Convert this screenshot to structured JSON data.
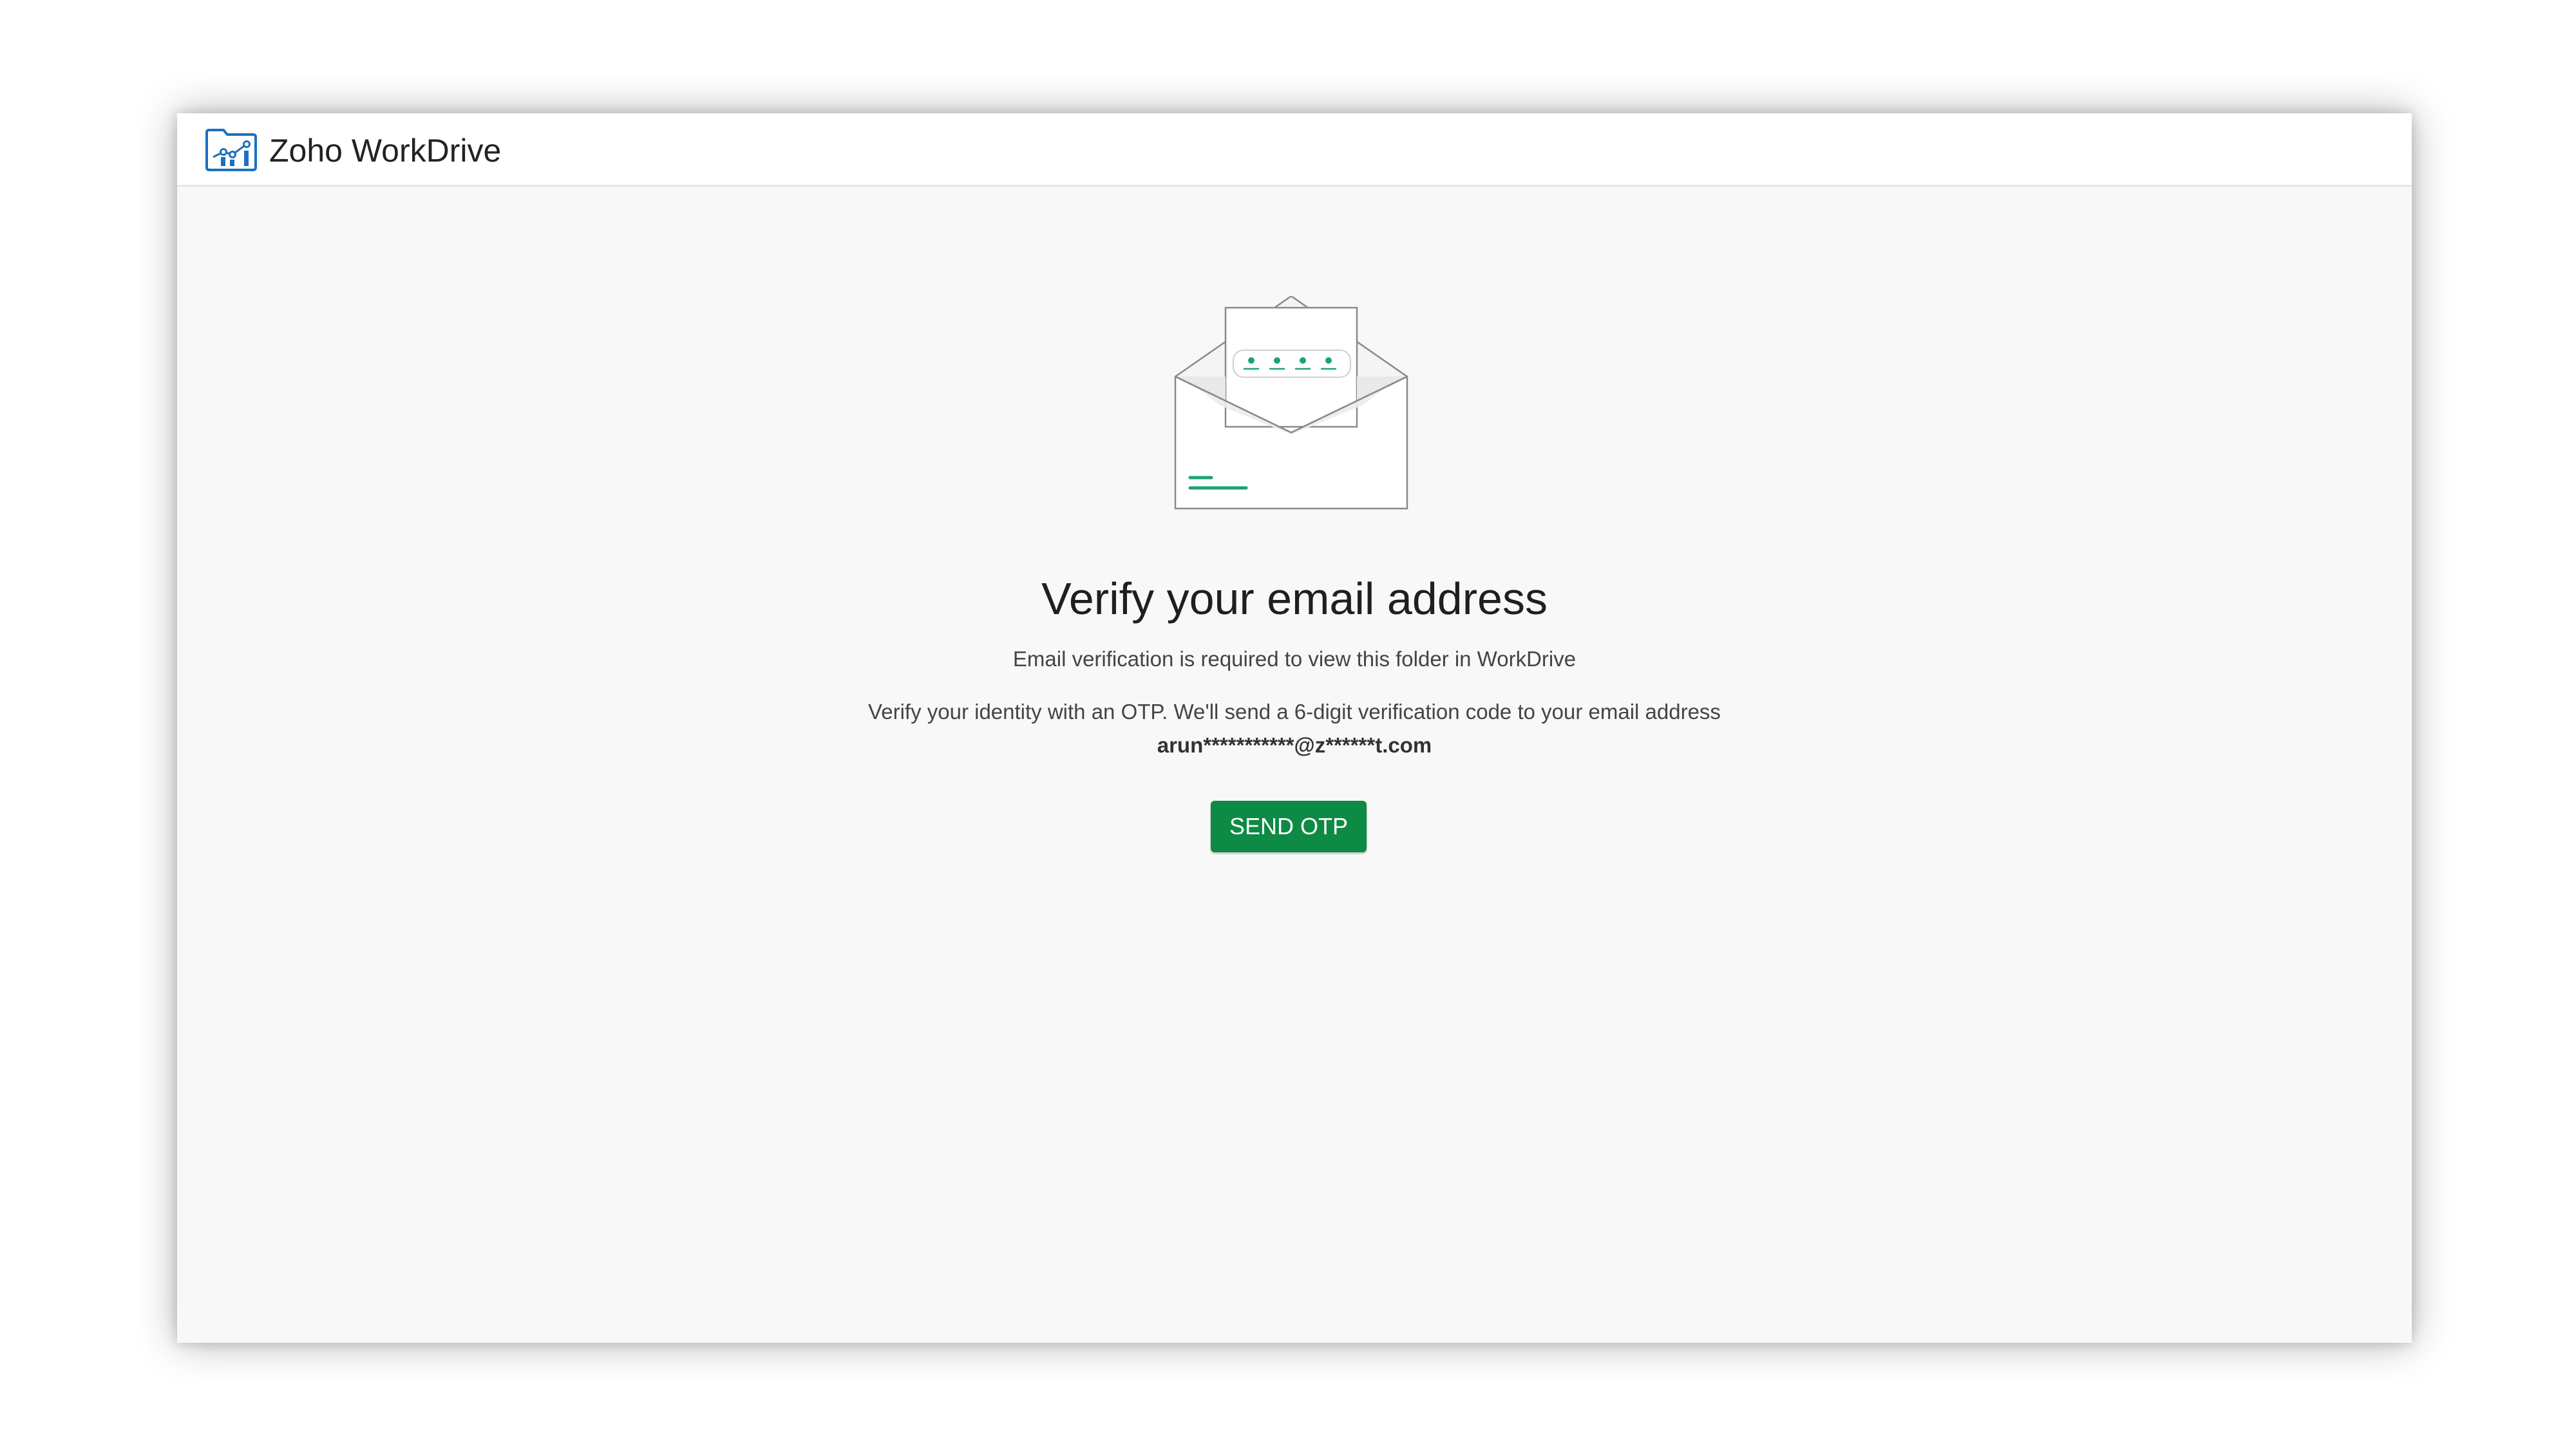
{
  "app": {
    "brand_name": "Zoho WorkDrive",
    "logo_icon": "workdrive-folder-icon"
  },
  "verify": {
    "illustration_icon": "open-envelope-otp-icon",
    "title": "Verify your email address",
    "subtitle": "Email verification is required to view this folder in WorkDrive",
    "info": "Verify your identity with an OTP. We'll send a 6-digit verification code to your email address",
    "masked_email": "arun***********@z******t.com",
    "send_button_label": "SEND OTP"
  },
  "colors": {
    "button_bg": "#0d8a43",
    "accent_teal": "#1aa37a",
    "logo_blue": "#1e6fc2",
    "page_bg": "#f8f8f8"
  }
}
